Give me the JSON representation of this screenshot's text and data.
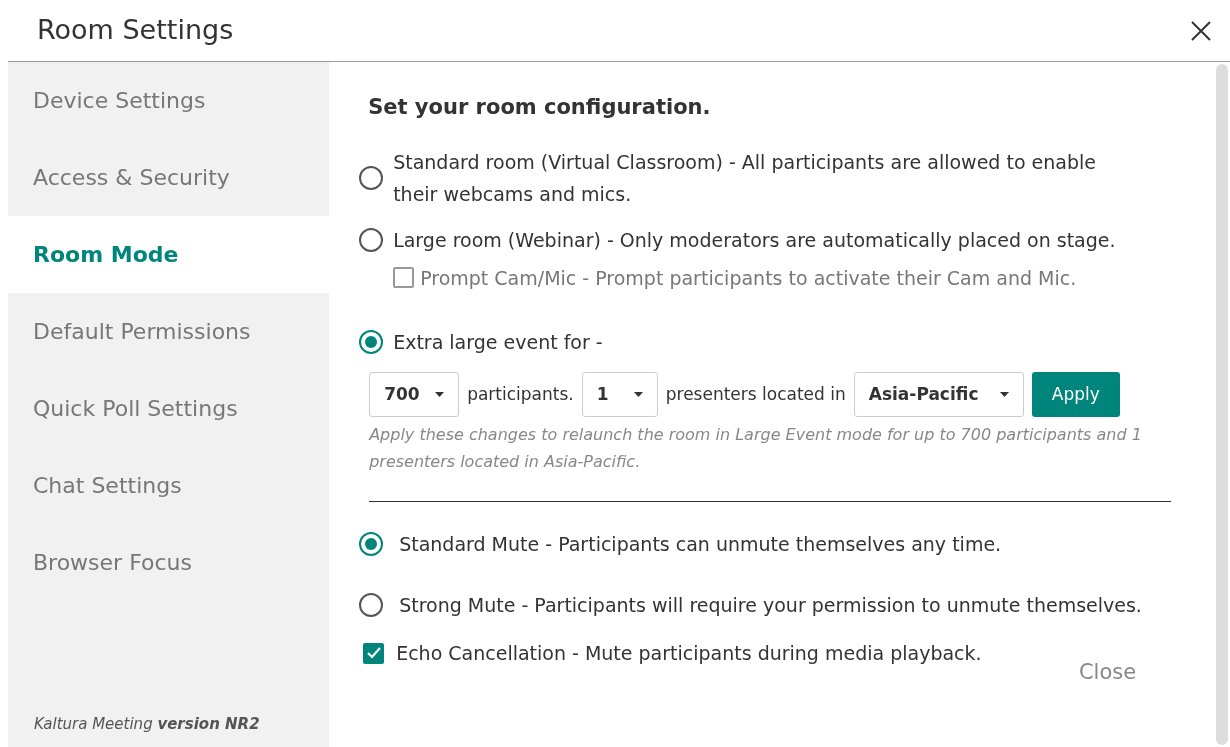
{
  "window": {
    "title": "Room Settings"
  },
  "sidebar": {
    "items": [
      {
        "label": "Device Settings",
        "selected": false
      },
      {
        "label": "Access & Security",
        "selected": false
      },
      {
        "label": "Room Mode",
        "selected": true
      },
      {
        "label": "Default Permissions",
        "selected": false
      },
      {
        "label": "Quick Poll Settings",
        "selected": false
      },
      {
        "label": "Chat Settings",
        "selected": false
      },
      {
        "label": "Browser Focus",
        "selected": false
      }
    ],
    "footer": "Kaltura Meeting **version NR2**"
  },
  "content": {
    "heading": "Set your room configuration.",
    "room_modes": [
      {
        "label": "Standard room (Virtual Classroom) - All participants are allowed to enable their webcams and mics.",
        "selected": false
      },
      {
        "label": "Large room (Webinar) - Only moderators are automatically placed on stage.",
        "selected": false,
        "option": {
          "label": "Prompt Cam/Mic - Prompt participants to activate their Cam and Mic.",
          "checked": false
        }
      },
      {
        "label": "Extra large event for -",
        "selected": true
      }
    ],
    "event": {
      "participants": "700",
      "participants_label": "participants.",
      "presenters": "1",
      "presenters_label": "presenters located in",
      "region": "Asia-Pacific",
      "apply": "Apply",
      "note": "Apply these changes to relaunch the room in Large Event mode for up to 700 participants and 1 presenters located in Asia-Pacific."
    },
    "mute_modes": [
      {
        "label": "Standard Mute - Participants can unmute themselves any time.",
        "selected": true
      },
      {
        "label": "Strong Mute - Participants will require your permission to unmute themselves.",
        "selected": false
      }
    ],
    "echo": {
      "label": "Echo Cancellation - Mute participants during media playback.",
      "checked": true
    },
    "close": "Close"
  }
}
